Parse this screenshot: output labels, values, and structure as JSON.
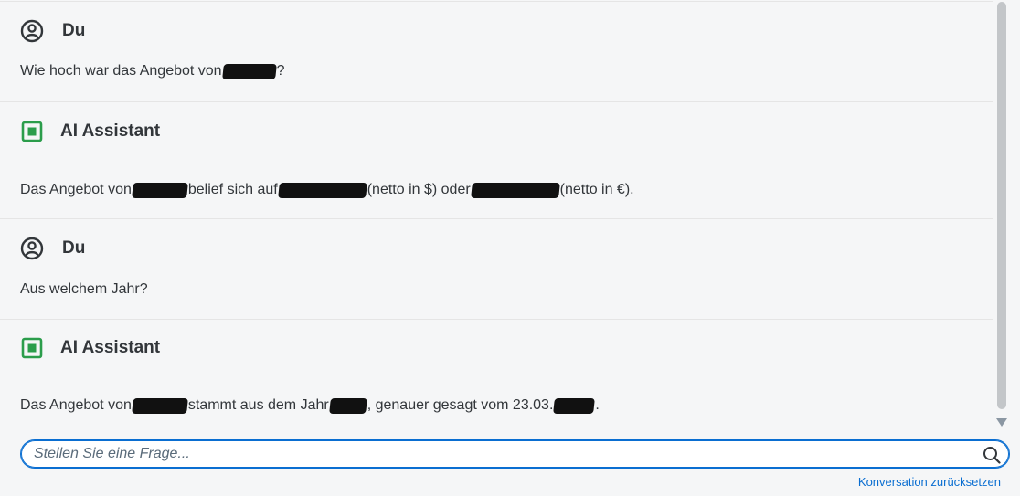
{
  "conversation": {
    "messages": [
      {
        "author": "Du",
        "role": "user",
        "icon": "user-circle-icon",
        "parts": [
          "Wie hoch war das Angebot von",
          "?"
        ]
      },
      {
        "author": "AI Assistant",
        "role": "assistant",
        "icon": "ai-assistant-icon",
        "parts": [
          "Das Angebot von",
          "belief sich auf",
          "(netto in $) oder",
          "(netto in €)."
        ]
      },
      {
        "author": "Du",
        "role": "user",
        "icon": "user-circle-icon",
        "parts": [
          "Aus welchem Jahr?"
        ]
      },
      {
        "author": "AI Assistant",
        "role": "assistant",
        "icon": "ai-assistant-icon",
        "parts": [
          "Das Angebot von",
          "stammt aus dem Jahr",
          ", genauer gesagt vom 23.03.",
          "."
        ]
      }
    ]
  },
  "input": {
    "placeholder": "Stellen Sie eine Frage...",
    "value": ""
  },
  "footer": {
    "reset_label": "Konversation zurücksetzen"
  },
  "colors": {
    "accent": "#0a6ed1",
    "assistant_icon": "#2b9d4b",
    "text": "#32363a",
    "background": "#f5f6f7"
  }
}
